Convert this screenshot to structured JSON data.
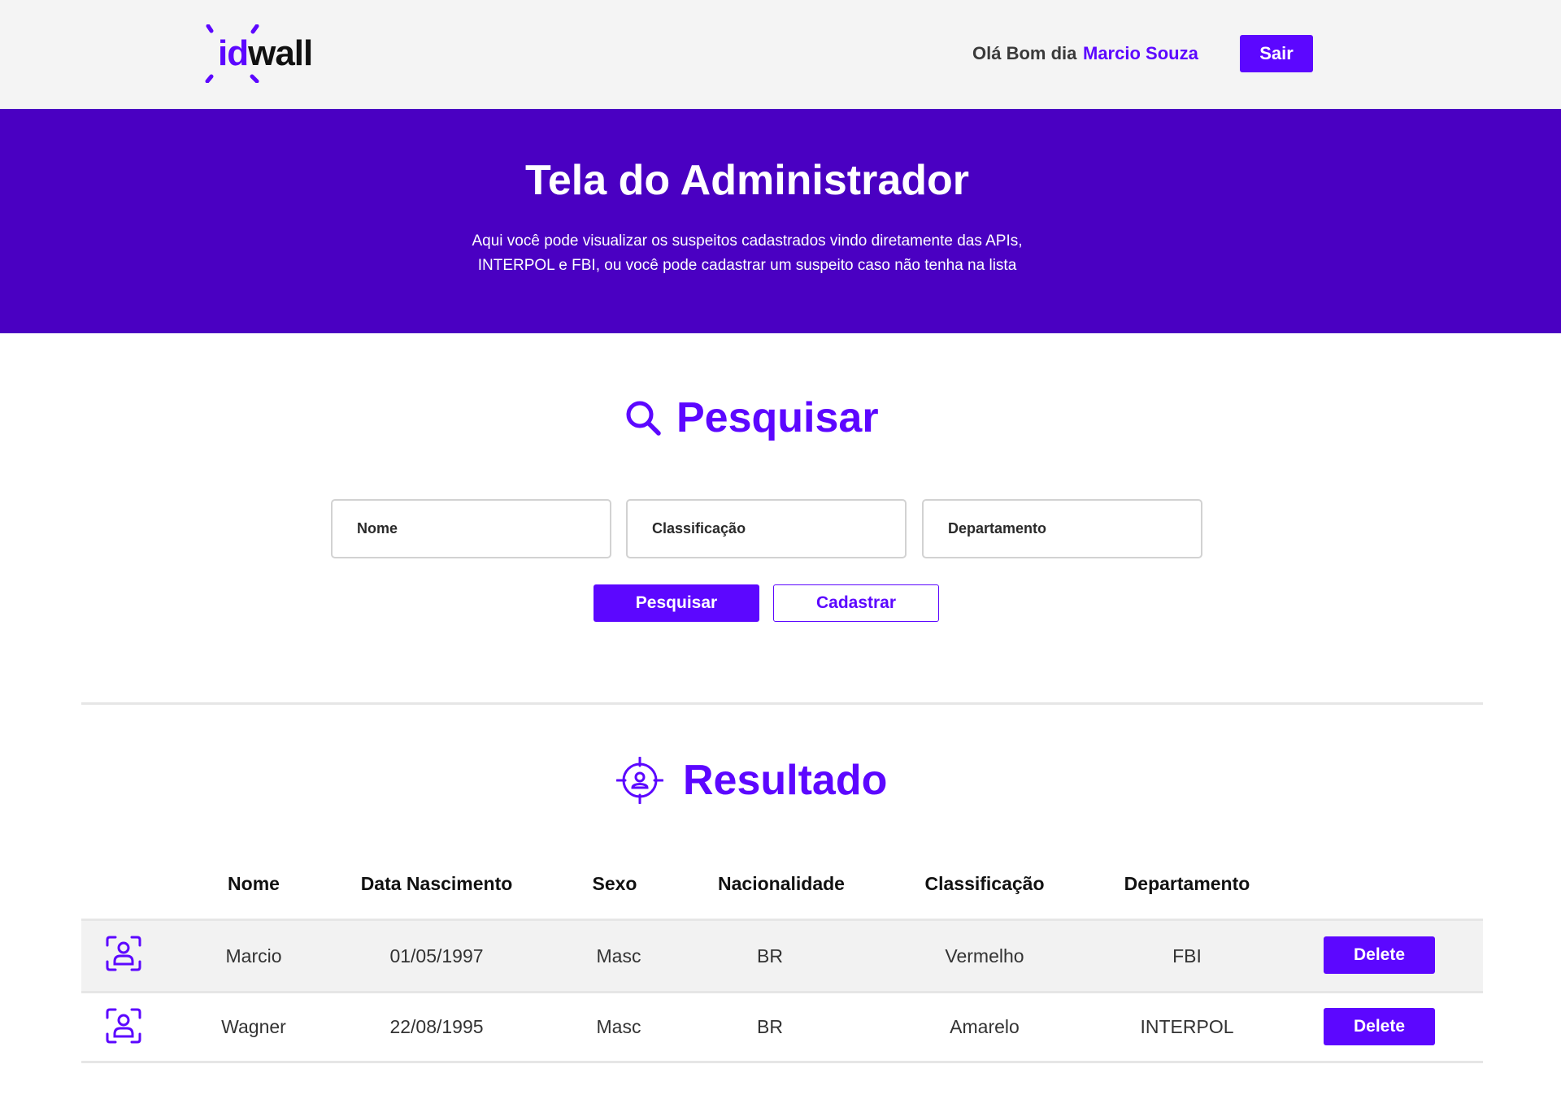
{
  "brand": {
    "logo_id": "id",
    "logo_wall": "wall",
    "accent": "#5c07ff",
    "hero_bg": "#4a00c2"
  },
  "header": {
    "greeting": "Olá Bom dia",
    "username": "Marcio Souza",
    "logout_label": "Sair"
  },
  "hero": {
    "title": "Tela do Administrador",
    "desc_line1": "Aqui você pode visualizar os suspeitos cadastrados vindo diretamente das APIs,",
    "desc_line2": "INTERPOL e FBI, ou você pode cadastrar um suspeito caso não tenha na lista"
  },
  "search": {
    "title": "Pesquisar",
    "icon": "search-icon",
    "fields": {
      "nome_placeholder": "Nome",
      "classificacao_placeholder": "Classificação",
      "departamento_placeholder": "Departamento"
    },
    "search_label": "Pesquisar",
    "register_label": "Cadastrar"
  },
  "results": {
    "title": "Resultado",
    "icon": "target-person-icon",
    "columns": [
      "Nome",
      "Data Nascimento",
      "Sexo",
      "Nacionalidade",
      "Classificação",
      "Departamento"
    ],
    "rows": [
      {
        "nome": "Marcio",
        "nascimento": "01/05/1997",
        "sexo": "Masc",
        "nacionalidade": "BR",
        "classificacao": "Vermelho",
        "departamento": "FBI",
        "action": "Delete"
      },
      {
        "nome": "Wagner",
        "nascimento": "22/08/1995",
        "sexo": "Masc",
        "nacionalidade": "BR",
        "classificacao": "Amarelo",
        "departamento": "INTERPOL",
        "action": "Delete"
      }
    ]
  }
}
